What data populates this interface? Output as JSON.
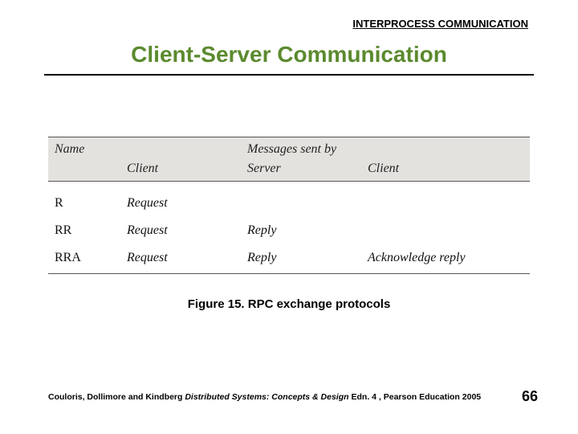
{
  "header": {
    "label": "INTERPROCESS COMMUNICATION"
  },
  "title": "Client-Server Communication",
  "table": {
    "header_name": "Name",
    "header_messages": "Messages sent by",
    "sub_client": "Client",
    "sub_server": "Server",
    "sub_client2": "Client",
    "rows": [
      {
        "name": "R",
        "client": "Request",
        "server": "",
        "client2": ""
      },
      {
        "name": "RR",
        "client": "Request",
        "server": "Reply",
        "client2": ""
      },
      {
        "name": "RRA",
        "client": "Request",
        "server": "Reply",
        "client2": "Acknowledge reply"
      }
    ]
  },
  "caption": "Figure 15. RPC exchange protocols",
  "citation": {
    "authors": "Couloris, Dollimore and Kindberg ",
    "title_ital": "Distributed Systems: Concepts & Design",
    "rest": "  Edn. 4 , Pearson Education 2005"
  },
  "page_number": "66"
}
